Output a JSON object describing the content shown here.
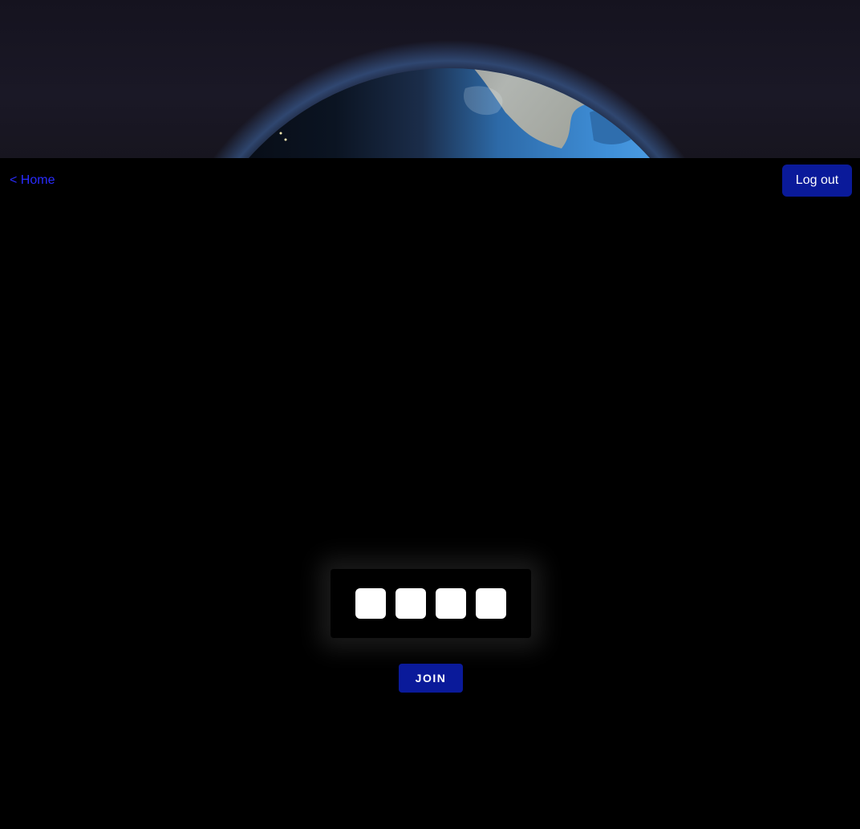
{
  "header": {
    "home_link": "< Home",
    "logout_label": "Log out"
  },
  "join_form": {
    "code_boxes": [
      "",
      "",
      "",
      ""
    ],
    "join_label": "JOIN"
  },
  "colors": {
    "background": "#000000",
    "link": "#2a2cff",
    "button": "#0a1a9a",
    "button_text": "#ffffff",
    "code_box": "#ffffff"
  }
}
